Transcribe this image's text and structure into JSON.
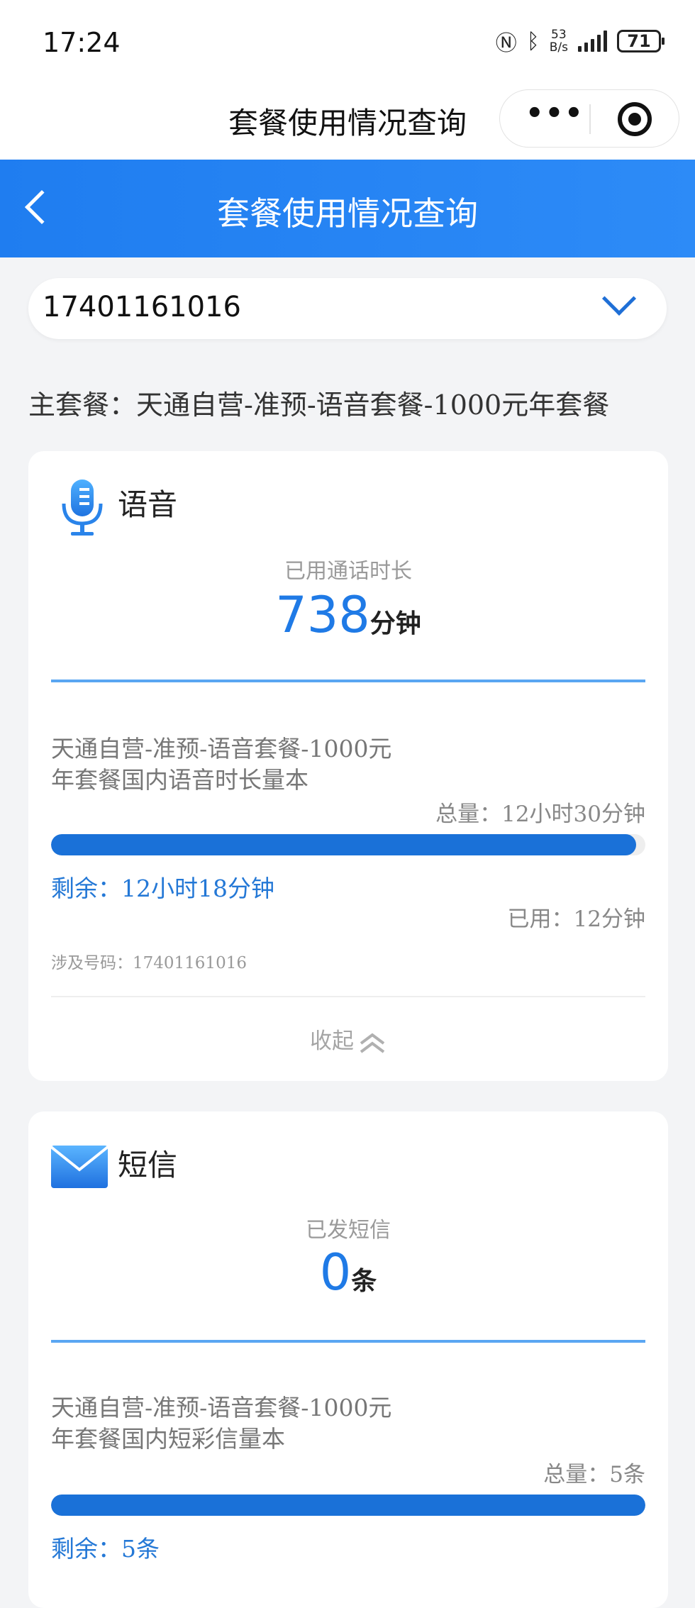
{
  "status_bar": {
    "time": "17:24",
    "network_speed_value": "53",
    "network_speed_unit": "B/s",
    "battery": "71",
    "icons": [
      "nfc-icon",
      "bluetooth-icon",
      "signal-icon",
      "battery-icon"
    ]
  },
  "mini_program": {
    "title": "套餐使用情况查询",
    "more_label": "•••"
  },
  "header": {
    "title": "套餐使用情况查询"
  },
  "phone_selector": {
    "value": "17401161016"
  },
  "main_plan": {
    "text": "主套餐：天通自营-准预-语音套餐-1000元年套餐"
  },
  "cards": [
    {
      "title": "语音",
      "icon": "microphone-icon",
      "metric_label": "已用通话时长",
      "metric_value": "738",
      "metric_unit": "分钟",
      "desc_line1": "天通自营-准预-语音套餐-1000元",
      "desc_line2": "年套餐国内语音时长量本",
      "total": "总量：12小时30分钟",
      "progress": 0.984,
      "remaining": "剩余：12小时18分钟",
      "used": "已用：12分钟",
      "involved": "涉及号码：17401161016",
      "collapse": "收起"
    },
    {
      "title": "短信",
      "icon": "envelope-icon",
      "metric_label": "已发短信",
      "metric_value": "0",
      "metric_unit": "条",
      "desc_line1": "天通自营-准预-语音套餐-1000元",
      "desc_line2": "年套餐国内短彩信量本",
      "total": "总量：5条",
      "progress": 1.0,
      "remaining": "剩余：5条"
    }
  ],
  "colors": {
    "header_blue": "#1f7df0",
    "accent_blue": "#1f7ae6",
    "progress_blue": "#1a71d8"
  }
}
